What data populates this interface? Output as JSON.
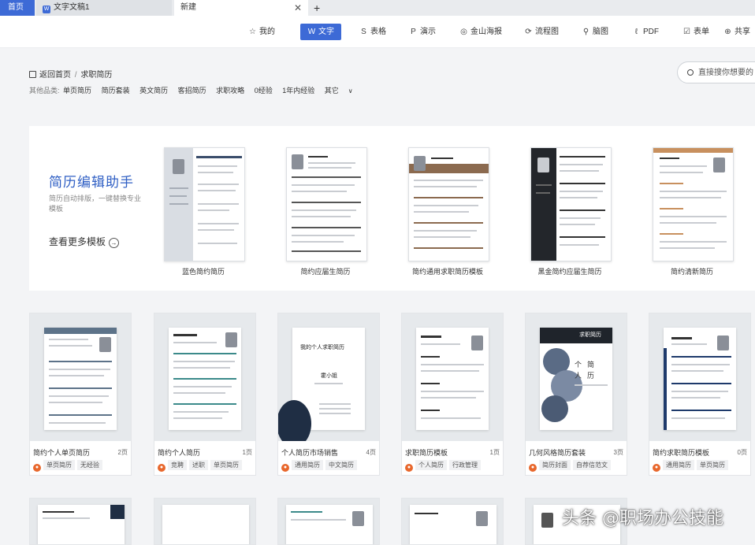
{
  "tabs": {
    "home": "首页",
    "doc": "文字文稿1",
    "new": "新建",
    "close": "✕",
    "add": "+"
  },
  "toolbar": {
    "items": [
      {
        "label": "我的",
        "icon": "☆"
      },
      {
        "label": "文字",
        "icon": "W"
      },
      {
        "label": "表格",
        "icon": "S"
      },
      {
        "label": "演示",
        "icon": "P"
      },
      {
        "label": "金山海报",
        "icon": "◎"
      },
      {
        "label": "流程图",
        "icon": "⟳"
      },
      {
        "label": "脑图",
        "icon": "⚲"
      },
      {
        "label": "PDF",
        "icon": "ℓ"
      },
      {
        "label": "表单",
        "icon": "☑"
      },
      {
        "label": "共享",
        "icon": "⊕"
      }
    ]
  },
  "breadcrumb": {
    "home": "返回首页",
    "sep": "/",
    "current": "求职简历"
  },
  "categories": {
    "label": "其他品类:",
    "items": [
      "单页简历",
      "简历套装",
      "英文简历",
      "客招简历",
      "求职攻略",
      "0经验",
      "1年内经验",
      "其它"
    ],
    "more_icon": "∨"
  },
  "search": {
    "placeholder": "直接搜你想要的"
  },
  "helper": {
    "title": "简历编辑助手",
    "subtitle": "简历自动排版，一键替换专业模板",
    "more": "查看更多模板",
    "more_icon": "→",
    "templates": [
      "蓝色简约简历",
      "简约应届生简历",
      "简约通用求职简历模板",
      "黑金简约应届生简历",
      "简约清新简历"
    ]
  },
  "grid": [
    {
      "title": "简约个人单页简历",
      "pages": "2页",
      "tags": [
        "单页简历",
        "无经验"
      ]
    },
    {
      "title": "简约个人简历",
      "pages": "1页",
      "tags": [
        "竞聘",
        "述职",
        "单页简历"
      ]
    },
    {
      "title": "个人简历市场销售",
      "pages": "4页",
      "tags": [
        "通用简历",
        "中文简历"
      ]
    },
    {
      "title": "求职简历模板",
      "pages": "1页",
      "tags": [
        "个人简历",
        "行政管理"
      ]
    },
    {
      "title": "几何风格简历套装",
      "pages": "3页",
      "tags": [
        "简历封面",
        "自荐信范文"
      ]
    },
    {
      "title": "简约求职简历模板",
      "pages": "0页",
      "tags": [
        "通用简历",
        "单页简历"
      ]
    }
  ],
  "cover_texts": {
    "sales_heading": "我的个人求职简历",
    "sales_name": "霍小姐",
    "geo_heading": "求职简历",
    "geo_char1": "个",
    "geo_char2": "人",
    "geo_char3": "简",
    "geo_char4": "历"
  },
  "watermark": "头条 @职场办公技能",
  "colors": {
    "accent": "#3d6ad6",
    "title_blue": "#2f5fc4",
    "fire": "#e8672c"
  }
}
